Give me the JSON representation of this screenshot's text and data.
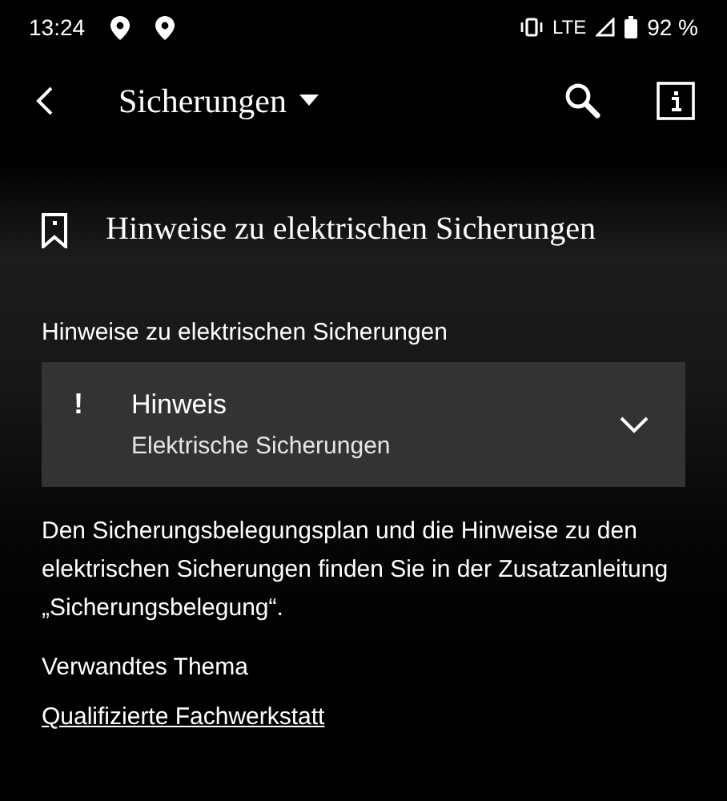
{
  "status_bar": {
    "time": "13:24",
    "network": "LTE",
    "battery": "92 %"
  },
  "app_bar": {
    "title": "Sicherungen"
  },
  "heading": {
    "title": "Hinweise zu elektrischen Sicherungen",
    "bookmarked": false
  },
  "section_label": "Hinweise zu elektrischen Sicherungen",
  "notice": {
    "symbol": "!",
    "title": "Hinweis",
    "subtitle": "Elektrische Sicherungen",
    "expanded": false
  },
  "paragraph": "Den Sicherungsbelegungsplan und die Hinweise zu den elektrischen Sicherungen finden Sie in der Zusatzanleitung „Sicherungsbelegung“.",
  "related": {
    "label": "Verwandtes Thema",
    "link": "Qualifizierte Fachwerkstatt"
  }
}
